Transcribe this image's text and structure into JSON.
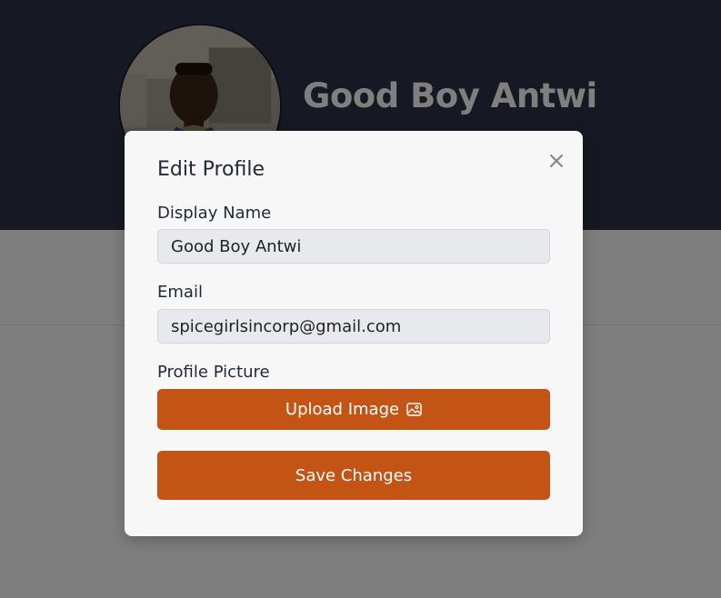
{
  "profile": {
    "name": "Good Boy Antwi",
    "avatar_alt": "Profile photo"
  },
  "modal": {
    "title": "Edit Profile",
    "close_icon": "close-icon",
    "display_name": {
      "label": "Display Name",
      "value": "Good Boy Antwi"
    },
    "email": {
      "label": "Email",
      "value": "spicegirlsincorp@gmail.com"
    },
    "profile_picture": {
      "label": "Profile Picture",
      "upload_label": "Upload Image",
      "upload_icon": "image-icon"
    },
    "save_label": "Save Changes"
  },
  "colors": {
    "hero_bg": "#2d3346",
    "accent": "#c45415",
    "modal_bg": "#f7f7f7",
    "input_bg": "#e8e9ed"
  }
}
